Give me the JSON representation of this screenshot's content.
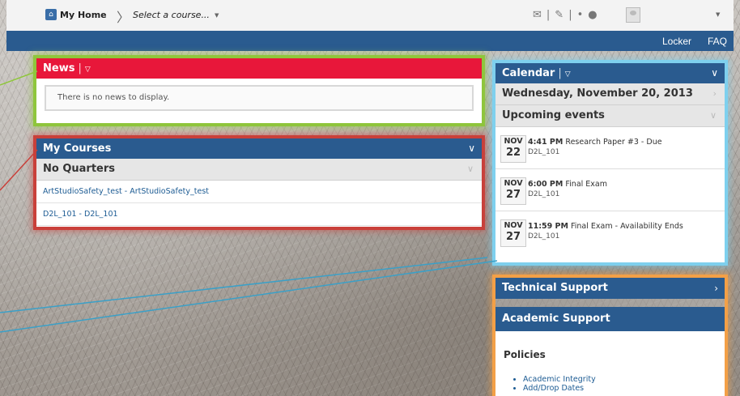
{
  "minibar": {
    "home_label": "My Home",
    "course_select": "Select a course...",
    "icons": [
      "mail-icon",
      "notes-icon",
      "chat-icon",
      "user-avatar"
    ]
  },
  "navbar": {
    "links": [
      "Locker",
      "FAQ"
    ]
  },
  "news": {
    "title": "News",
    "empty_text": "There is no news to display."
  },
  "my_courses": {
    "title": "My Courses",
    "group": "No Quarters",
    "courses": [
      "ArtStudioSafety_test - ArtStudioSafety_test",
      "D2L_101 - D2L_101"
    ]
  },
  "calendar": {
    "title": "Calendar",
    "date": "Wednesday, November 20, 2013",
    "upcoming_label": "Upcoming events",
    "events": [
      {
        "month": "NOV",
        "day": "22",
        "time": "4:41 PM",
        "title": "Research Paper #3 - Due",
        "course": "D2L_101"
      },
      {
        "month": "NOV",
        "day": "27",
        "time": "6:00 PM",
        "title": "Final Exam",
        "course": "D2L_101"
      },
      {
        "month": "NOV",
        "day": "27",
        "time": "11:59 PM",
        "title": "Final Exam - Availability Ends",
        "course": "D2L_101"
      }
    ]
  },
  "support": {
    "technical": "Technical Support",
    "academic": "Academic Support",
    "policies_heading": "Policies",
    "policies": [
      "Academic Integrity",
      "Add/Drop Dates"
    ]
  },
  "colors": {
    "news_red": "#e8173a",
    "brand_blue": "#2a5b8f",
    "highlight_green": "#8fc63c",
    "highlight_red": "#c9403a",
    "highlight_blue": "#7ed0ee",
    "highlight_orange": "#f3a047"
  }
}
